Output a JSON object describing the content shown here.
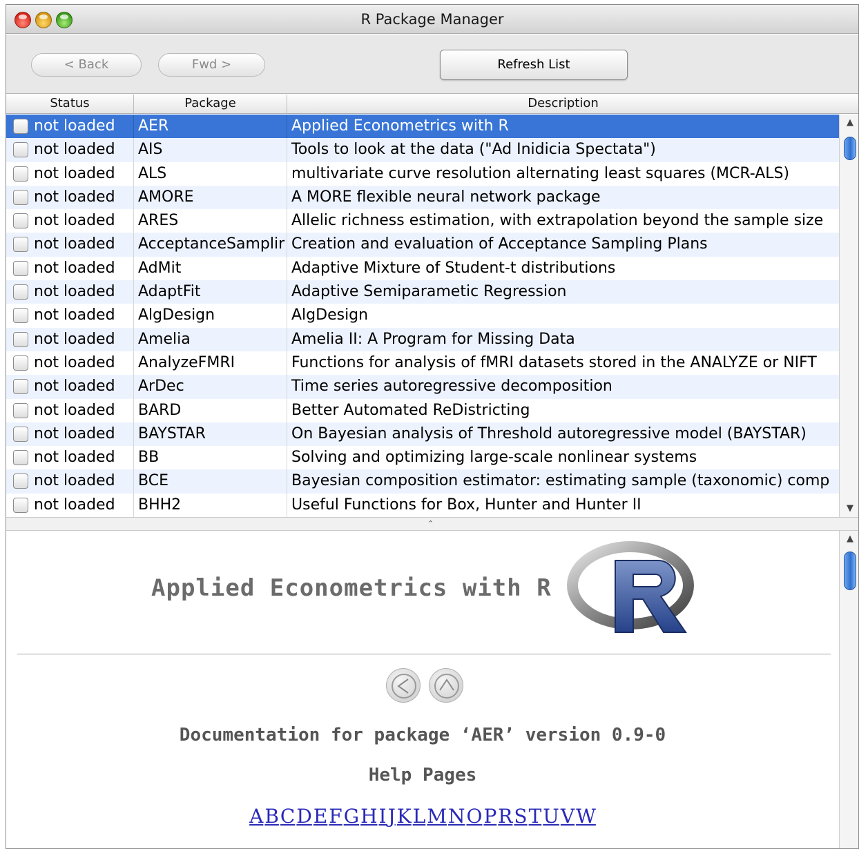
{
  "window": {
    "title": "R Package Manager"
  },
  "toolbar": {
    "back_label": "< Back",
    "fwd_label": "Fwd >",
    "refresh_label": "Refresh List"
  },
  "table": {
    "columns": [
      "Status",
      "Package",
      "Description"
    ],
    "rows": [
      {
        "status": "not loaded",
        "package": "AER",
        "description": "Applied Econometrics with R",
        "selected": true
      },
      {
        "status": "not loaded",
        "package": "AIS",
        "description": "Tools to look at the data (\"Ad Inidicia Spectata\")"
      },
      {
        "status": "not loaded",
        "package": "ALS",
        "description": "multivariate curve resolution alternating least squares (MCR-ALS)"
      },
      {
        "status": "not loaded",
        "package": "AMORE",
        "description": "A MORE flexible neural network package"
      },
      {
        "status": "not loaded",
        "package": "ARES",
        "description": "Allelic richness estimation, with extrapolation beyond the sample size"
      },
      {
        "status": "not loaded",
        "package": "AcceptanceSamplir",
        "description": "Creation and evaluation of Acceptance Sampling Plans"
      },
      {
        "status": "not loaded",
        "package": "AdMit",
        "description": "Adaptive Mixture of Student-t distributions"
      },
      {
        "status": "not loaded",
        "package": "AdaptFit",
        "description": "Adaptive Semiparametic Regression"
      },
      {
        "status": "not loaded",
        "package": "AlgDesign",
        "description": "AlgDesign"
      },
      {
        "status": "not loaded",
        "package": "Amelia",
        "description": "Amelia II: A Program for Missing Data"
      },
      {
        "status": "not loaded",
        "package": "AnalyzeFMRI",
        "description": "Functions for analysis of fMRI datasets stored in the ANALYZE or NIFT"
      },
      {
        "status": "not loaded",
        "package": "ArDec",
        "description": "Time series autoregressive decomposition"
      },
      {
        "status": "not loaded",
        "package": "BARD",
        "description": "Better Automated ReDistricting"
      },
      {
        "status": "not loaded",
        "package": "BAYSTAR",
        "description": "On Bayesian analysis of Threshold autoregressive model (BAYSTAR)"
      },
      {
        "status": "not loaded",
        "package": "BB",
        "description": "Solving and optimizing large-scale nonlinear systems"
      },
      {
        "status": "not loaded",
        "package": "BCE",
        "description": "Bayesian composition estimator: estimating sample (taxonomic) comp"
      },
      {
        "status": "not loaded",
        "package": "BHH2",
        "description": "Useful Functions for Box, Hunter and Hunter II"
      }
    ]
  },
  "doc": {
    "title": "Applied Econometrics with R",
    "heading": "Documentation for package ‘AER’ version 0.9-0",
    "subheading": "Help Pages",
    "letters": [
      "A",
      "B",
      "C",
      "D",
      "E",
      "F",
      "G",
      "H",
      "I",
      "J",
      "K",
      "L",
      "M",
      "N",
      "O",
      "P",
      "R",
      "S",
      "T",
      "U",
      "V",
      "W"
    ]
  },
  "colors": {
    "selection": "#3875d7",
    "alt_row": "#edf3fe",
    "link": "#2a2ab8"
  },
  "icons": [
    "close-light",
    "minimize-light",
    "zoom-light",
    "checkbox",
    "r-logo",
    "prev-arrow-icon",
    "up-arrow-icon"
  ]
}
